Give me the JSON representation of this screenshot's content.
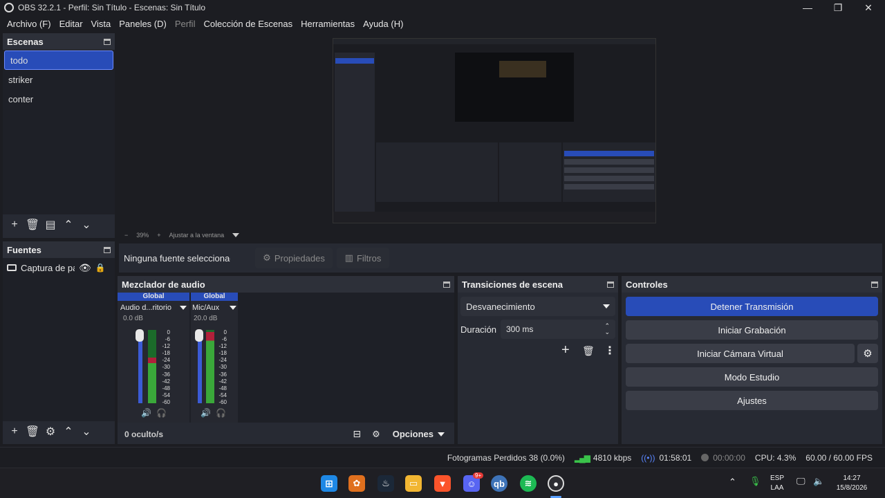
{
  "window": {
    "title": "OBS 32.2.1 - Perfil: Sin Título - Escenas: Sin Título"
  },
  "menu": [
    {
      "label": "Archivo (F)",
      "enabled": true
    },
    {
      "label": "Editar",
      "enabled": true
    },
    {
      "label": "Vista",
      "enabled": true
    },
    {
      "label": "Paneles (D)",
      "enabled": true
    },
    {
      "label": "Perfil",
      "enabled": false
    },
    {
      "label": "Colección de Escenas",
      "enabled": true
    },
    {
      "label": "Herramientas",
      "enabled": true
    },
    {
      "label": "Ayuda (H)",
      "enabled": true
    }
  ],
  "scenes": {
    "title": "Escenas",
    "items": [
      "todo",
      "striker",
      "conter"
    ],
    "selected": "todo"
  },
  "sources": {
    "title": "Fuentes",
    "items": [
      {
        "label": "Captura de pa",
        "visible": true,
        "locked": true
      }
    ]
  },
  "preview": {
    "zoom": "39%",
    "fit_label": "Ajustar a la ventana"
  },
  "source_bar": {
    "no_source": "Ninguna fuente seleccionad",
    "properties": "Propiedades",
    "filters": "Filtros"
  },
  "mixer": {
    "title": "Mezclador de audio",
    "channels": [
      {
        "group": "Global",
        "name": "Audio d...ritorio",
        "db": "0.0 dB",
        "level": 0.62
      },
      {
        "group": "Global",
        "name": "Mic/Aux",
        "db": "20.0 dB",
        "level": 0.97
      }
    ],
    "scale": [
      "0",
      "-6",
      "-12",
      "-18",
      "-24",
      "-30",
      "-36",
      "-42",
      "-48",
      "-54",
      "-60"
    ],
    "hidden": "0 oculto/s",
    "options": "Opciones"
  },
  "transitions": {
    "title": "Transiciones de escena",
    "selected": "Desvanecimiento",
    "duration_label": "Duración",
    "duration_value": "300 ms"
  },
  "controls": {
    "title": "Controles",
    "stop_stream": "Detener Transmisión",
    "start_record": "Iniciar Grabación",
    "virtual_cam": "Iniciar Cámara Virtual",
    "studio_mode": "Modo Estudio",
    "settings": "Ajustes"
  },
  "status": {
    "dropped": "Fotogramas Perdidos 38 (0.0%)",
    "bitrate": "4810 kbps",
    "stream_time": "01:58:01",
    "record_time": "00:00:00",
    "cpu": "CPU: 4.3%",
    "fps": "60.00 / 60.00 FPS"
  },
  "taskbar": {
    "discord_badge": "9+",
    "lang_top": "ESP",
    "lang_bottom": "LAA",
    "time": "14:27",
    "date": "15/8/2026"
  },
  "colors": {
    "accent": "#284cb8",
    "panel": "#272a33",
    "background": "#1c1d22"
  }
}
